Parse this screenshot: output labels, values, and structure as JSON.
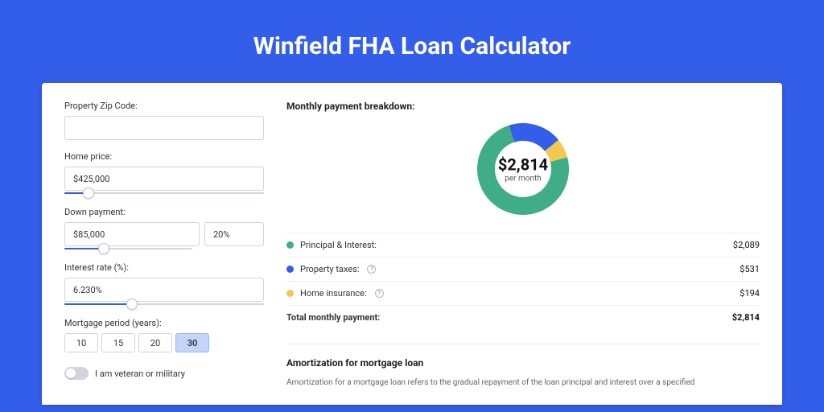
{
  "page_title": "Winfield FHA Loan Calculator",
  "form": {
    "zip": {
      "label": "Property Zip Code:",
      "value": ""
    },
    "home_price": {
      "label": "Home price:",
      "value": "$425,000",
      "slider_pct": 12
    },
    "down_payment": {
      "label": "Down payment:",
      "value": "$85,000",
      "pct": "20%",
      "slider_pct": 20
    },
    "interest_rate": {
      "label": "Interest rate (%):",
      "value": "6.230%",
      "slider_pct": 34
    },
    "mortgage_period": {
      "label": "Mortgage period (years):",
      "options": [
        "10",
        "15",
        "20",
        "30"
      ],
      "selected": "30"
    },
    "veteran": {
      "label": "I am veteran or military",
      "checked": false
    }
  },
  "breakdown": {
    "title": "Monthly payment breakdown:",
    "center_amount": "$2,814",
    "center_sub": "per month",
    "items": [
      {
        "label": "Principal & Interest:",
        "value": "$2,089",
        "color": "#3fae87",
        "pct": 74,
        "info": false
      },
      {
        "label": "Property taxes:",
        "value": "$531",
        "color": "#335eea",
        "pct": 19,
        "info": true
      },
      {
        "label": "Home insurance:",
        "value": "$194",
        "color": "#f2c94c",
        "pct": 7,
        "info": true
      }
    ],
    "total": {
      "label": "Total monthly payment:",
      "value": "$2,814"
    }
  },
  "amortization": {
    "title": "Amortization for mortgage loan",
    "text": "Amortization for a mortgage loan refers to the gradual repayment of the loan principal and interest over a specified"
  },
  "chart_data": {
    "type": "pie",
    "title": "Monthly payment breakdown",
    "categories": [
      "Principal & Interest",
      "Property taxes",
      "Home insurance"
    ],
    "values": [
      2089,
      531,
      194
    ],
    "total": 2814,
    "colors": [
      "#3fae87",
      "#335eea",
      "#f2c94c"
    ],
    "center_label": "$2,814 per month"
  }
}
